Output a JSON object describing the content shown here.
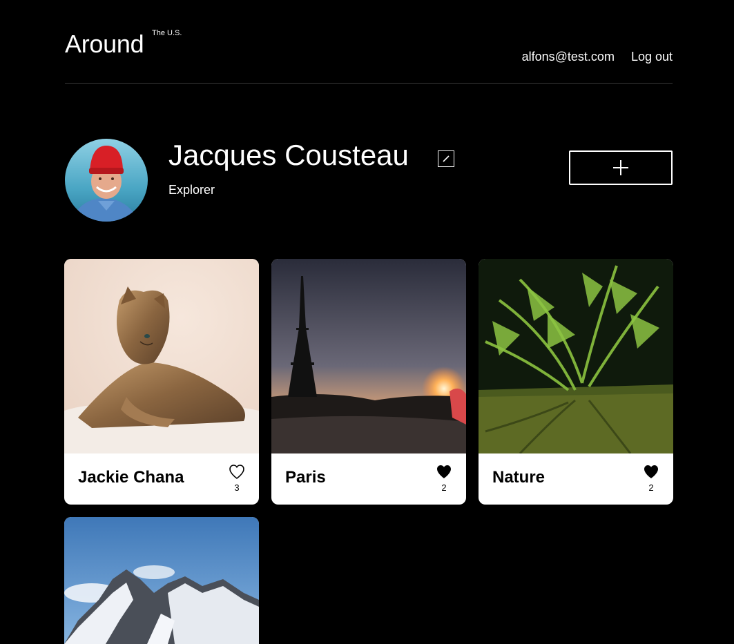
{
  "header": {
    "logo": "Around",
    "logo_sup": "The U.S.",
    "email": "alfons@test.com",
    "logout": "Log out"
  },
  "profile": {
    "name": "Jacques Cousteau",
    "about": "Explorer"
  },
  "cards": [
    {
      "title": "Jackie Chana",
      "likes": "3",
      "liked": false
    },
    {
      "title": "Paris",
      "likes": "2",
      "liked": true
    },
    {
      "title": "Nature",
      "likes": "2",
      "liked": true
    },
    {
      "title": "",
      "likes": "",
      "liked": false
    }
  ]
}
